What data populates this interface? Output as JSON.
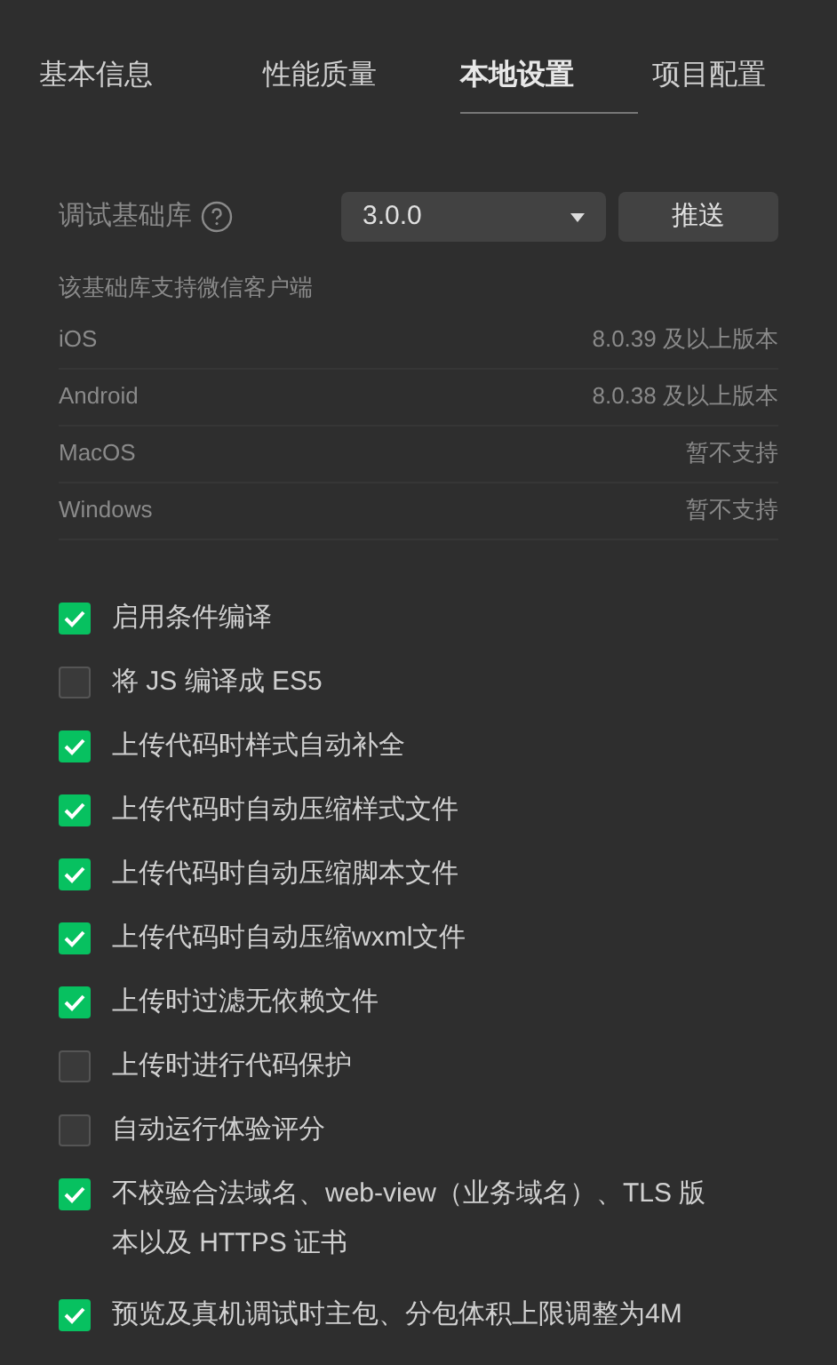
{
  "tabs": [
    {
      "label": "基本信息",
      "selected": false
    },
    {
      "label": "性能质量",
      "selected": false
    },
    {
      "label": "本地设置",
      "selected": true
    },
    {
      "label": "项目配置",
      "selected": false
    }
  ],
  "debug_library": {
    "label": "调试基础库",
    "version": "3.0.0",
    "push_button": "推送"
  },
  "support": {
    "heading": "该基础库支持微信客户端",
    "rows": [
      {
        "platform": "iOS",
        "value": "8.0.39 及以上版本"
      },
      {
        "platform": "Android",
        "value": "8.0.38 及以上版本"
      },
      {
        "platform": "MacOS",
        "value": "暂不支持"
      },
      {
        "platform": "Windows",
        "value": "暂不支持"
      }
    ]
  },
  "options": [
    {
      "label": "启用条件编译",
      "checked": true
    },
    {
      "label": "将 JS 编译成 ES5",
      "checked": false
    },
    {
      "label": "上传代码时样式自动补全",
      "checked": true
    },
    {
      "label": "上传代码时自动压缩样式文件",
      "checked": true
    },
    {
      "label": "上传代码时自动压缩脚本文件",
      "checked": true
    },
    {
      "label": "上传代码时自动压缩wxml文件",
      "checked": true
    },
    {
      "label": "上传时过滤无依赖文件",
      "checked": true
    },
    {
      "label": "上传时进行代码保护",
      "checked": false
    },
    {
      "label": "自动运行体验评分",
      "checked": false
    },
    {
      "label": "不校验合法域名、web-view（业务域名）、TLS 版本以及 HTTPS 证书",
      "checked": true
    },
    {
      "label": "预览及真机调试时主包、分包体积上限调整为4M",
      "checked": true
    }
  ]
}
